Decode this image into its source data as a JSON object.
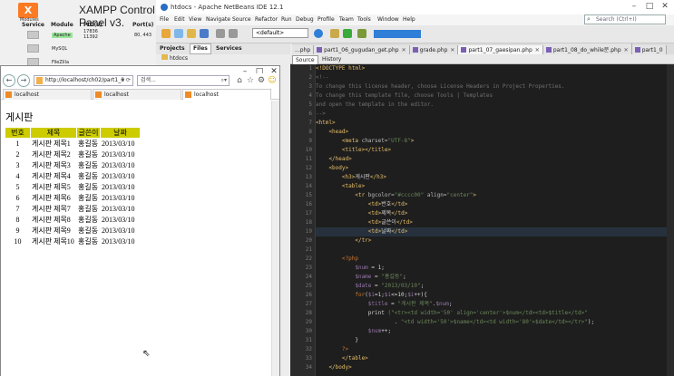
{
  "xampp": {
    "logo_text": "Modules",
    "title": "XAMPP Control Panel v3.",
    "headers": {
      "service": "Service",
      "module": "Module",
      "pids": "PID(s)",
      "ports": "Port(s)"
    },
    "rows": [
      {
        "module": "Apache",
        "pids": "17836\n11392",
        "ports": "80, 443"
      },
      {
        "module": "MySQL",
        "pids": "",
        "ports": ""
      },
      {
        "module": "FileZilla",
        "pids": "",
        "ports": ""
      }
    ]
  },
  "netbeans": {
    "title": "htdocs - Apache NetBeans IDE 12.1",
    "menu": [
      "File",
      "Edit",
      "View",
      "Navigate",
      "Source",
      "Refactor",
      "Run",
      "Debug",
      "Profile",
      "Team",
      "Tools",
      "Window",
      "Help"
    ],
    "search_placeholder": "Search (Ctrl+I)",
    "config": "<default>",
    "project_tabs": [
      "Projects",
      "Files",
      "Services"
    ],
    "project_node": "htdocs",
    "editor_tabs": [
      "...php",
      "part1_06_gugudan_get.php",
      "grade.php",
      "part1_07_gaesipan.php",
      "part1_08_do_while문.php",
      "part1_0"
    ],
    "editor_buttons": [
      "Source",
      "History"
    ],
    "line_numbers": [
      "1",
      "2",
      "3",
      "4",
      "5",
      "6",
      "7",
      "8",
      "9",
      "10",
      "11",
      "12",
      "13",
      "14",
      "15",
      "16",
      "17",
      "18",
      "19",
      "20",
      "21",
      "22",
      "23",
      "24",
      "25",
      "26",
      "27",
      "28",
      "29",
      "30",
      "31",
      "32",
      "33",
      "34"
    ]
  },
  "browser": {
    "address": "http://localhost/ch02/part1_0",
    "search_text": "검색...",
    "tabs": [
      "localhost",
      "localhost",
      "localhost"
    ],
    "page_title": "게시판",
    "table": {
      "headers": [
        "번호",
        "제목",
        "글쓴이",
        "날짜"
      ],
      "rows": [
        [
          "1",
          "게시판 제목1",
          "홍길동",
          "2013/03/10"
        ],
        [
          "2",
          "게시판 제목2",
          "홍길동",
          "2013/03/10"
        ],
        [
          "3",
          "게시판 제목3",
          "홍길동",
          "2013/03/10"
        ],
        [
          "4",
          "게시판 제목4",
          "홍길동",
          "2013/03/10"
        ],
        [
          "5",
          "게시판 제목5",
          "홍길동",
          "2013/03/10"
        ],
        [
          "6",
          "게시판 제목6",
          "홍길동",
          "2013/03/10"
        ],
        [
          "7",
          "게시판 제목7",
          "홍길동",
          "2013/03/10"
        ],
        [
          "8",
          "게시판 제목8",
          "홍길동",
          "2013/03/10"
        ],
        [
          "9",
          "게시판 제목9",
          "홍길동",
          "2013/03/10"
        ],
        [
          "10",
          "게시판 제목10",
          "홍길동",
          "2013/03/10"
        ]
      ]
    }
  },
  "code_lines": [
    [
      [
        "tag",
        "<!DOCTYPE html>"
      ]
    ],
    [
      [
        "comment",
        "<!--"
      ]
    ],
    [
      [
        "comment",
        "To change this license header, choose License Headers in Project Properties."
      ]
    ],
    [
      [
        "comment",
        "To change this template file, choose Tools | Templates"
      ]
    ],
    [
      [
        "comment",
        "and open the template in the editor."
      ]
    ],
    [
      [
        "comment",
        "-->"
      ]
    ],
    [
      [
        "tag",
        "<html>"
      ]
    ],
    [
      [
        "tag",
        "    <head>"
      ]
    ],
    [
      [
        "tag",
        "        <meta "
      ],
      [
        "attr",
        "charset="
      ],
      [
        "str",
        "\"UTF-8\""
      ],
      [
        "tag",
        ">"
      ]
    ],
    [
      [
        "tag",
        "        <title>"
      ],
      [
        "tag",
        "</title>"
      ]
    ],
    [
      [
        "tag",
        "    </head>"
      ]
    ],
    [
      [
        "tag",
        "    <body>"
      ]
    ],
    [
      [
        "tag",
        "        <h3>"
      ],
      [
        "plain",
        "게시판"
      ],
      [
        "tag",
        "</h3>"
      ]
    ],
    [
      [
        "tag",
        "        <table>"
      ]
    ],
    [
      [
        "tag",
        "            <tr "
      ],
      [
        "attr",
        "bgcolor="
      ],
      [
        "str",
        "\"#cccc00\""
      ],
      [
        "attr",
        " align="
      ],
      [
        "str",
        "\"center\""
      ],
      [
        "tag",
        ">"
      ]
    ],
    [
      [
        "tag",
        "                <td>"
      ],
      [
        "plain",
        "번호"
      ],
      [
        "tag",
        "</td>"
      ]
    ],
    [
      [
        "tag",
        "                <td>"
      ],
      [
        "plain",
        "제목"
      ],
      [
        "tag",
        "</td>"
      ]
    ],
    [
      [
        "tag",
        "                <td>"
      ],
      [
        "plain",
        "글쓴이"
      ],
      [
        "tag",
        "</td>"
      ]
    ],
    [
      [
        "tag",
        "                <td>"
      ],
      [
        "plain",
        "날짜"
      ],
      [
        "tag",
        "</td>"
      ]
    ],
    [
      [
        "tag",
        "            </tr>"
      ]
    ],
    [
      [
        "plain",
        ""
      ]
    ],
    [
      [
        "kw",
        "        <?php"
      ]
    ],
    [
      [
        "var",
        "            $num"
      ],
      [
        "plain",
        " = 1;"
      ]
    ],
    [
      [
        "var",
        "            $name"
      ],
      [
        "plain",
        " = "
      ],
      [
        "str",
        "\"홍길동\""
      ],
      [
        "plain",
        ";"
      ]
    ],
    [
      [
        "var",
        "            $date"
      ],
      [
        "plain",
        " = "
      ],
      [
        "str",
        "\"2013/03/10\""
      ],
      [
        "plain",
        ";"
      ]
    ],
    [
      [
        "kw",
        "            for"
      ],
      [
        "plain",
        "("
      ],
      [
        "var",
        "$i"
      ],
      [
        "plain",
        "=1;"
      ],
      [
        "var",
        "$i"
      ],
      [
        "plain",
        "<=10;"
      ],
      [
        "var",
        "$i"
      ],
      [
        "plain",
        "++){"
      ]
    ],
    [
      [
        "var",
        "                $title"
      ],
      [
        "plain",
        " = "
      ],
      [
        "str",
        "\"게시판 제목\""
      ],
      [
        "plain",
        "."
      ],
      [
        "var",
        "$num"
      ],
      [
        "plain",
        ";"
      ]
    ],
    [
      [
        "plain",
        "                print "
      ],
      [
        "str",
        "(\"<tr><td width='50' align='center'>$num</td><td>$title</td>\""
      ]
    ],
    [
      [
        "plain",
        "                        . "
      ],
      [
        "str",
        "\"<td width='50'>$name</td><td width='80'>$date</td></tr>\""
      ],
      [
        "plain",
        ");"
      ]
    ],
    [
      [
        "var",
        "                $num"
      ],
      [
        "plain",
        "++;"
      ]
    ],
    [
      [
        "plain",
        "            }"
      ]
    ],
    [
      [
        "kw",
        "        ?>"
      ]
    ],
    [
      [
        "tag",
        "        </table>"
      ]
    ],
    [
      [
        "tag",
        "    </body>"
      ]
    ]
  ]
}
